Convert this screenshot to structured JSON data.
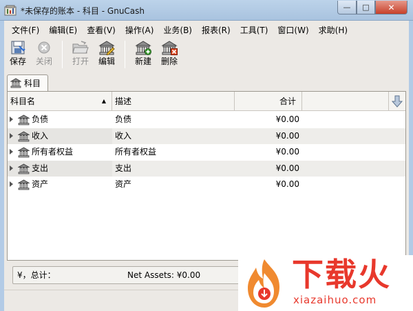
{
  "window": {
    "title": "*未保存的账本 - 科目 - GnuCash",
    "minimize_glyph": "—",
    "maximize_glyph": "□",
    "close_glyph": "✕"
  },
  "menubar": {
    "items": [
      "文件(F)",
      "编辑(E)",
      "查看(V)",
      "操作(A)",
      "业务(B)",
      "报表(R)",
      "工具(T)",
      "窗口(W)",
      "求助(H)"
    ]
  },
  "toolbar": {
    "save_label": "保存",
    "close_label": "关闭",
    "open_label": "打开",
    "edit_label": "编辑",
    "new_label": "新建",
    "delete_label": "删除"
  },
  "tab": {
    "label": "科目"
  },
  "table": {
    "columns": {
      "name": "科目名",
      "description": "描述",
      "total": "合计"
    },
    "sort_glyph": "▲",
    "rows": [
      {
        "name": "负债",
        "description": "负债",
        "total": "¥0.00"
      },
      {
        "name": "收入",
        "description": "收入",
        "total": "¥0.00"
      },
      {
        "name": "所有者权益",
        "description": "所有者权益",
        "total": "¥0.00"
      },
      {
        "name": "支出",
        "description": "支出",
        "total": "¥0.00"
      },
      {
        "name": "资产",
        "description": "资产",
        "total": "¥0.00"
      }
    ]
  },
  "summary": {
    "label": "¥，总计：",
    "net_assets": "Net Assets: ¥0.00"
  },
  "watermark": {
    "title": "下载火",
    "url": "xiazaihuo.com"
  },
  "colors": {
    "accent": "#e8382c",
    "titlebar": "#a9c3df"
  }
}
